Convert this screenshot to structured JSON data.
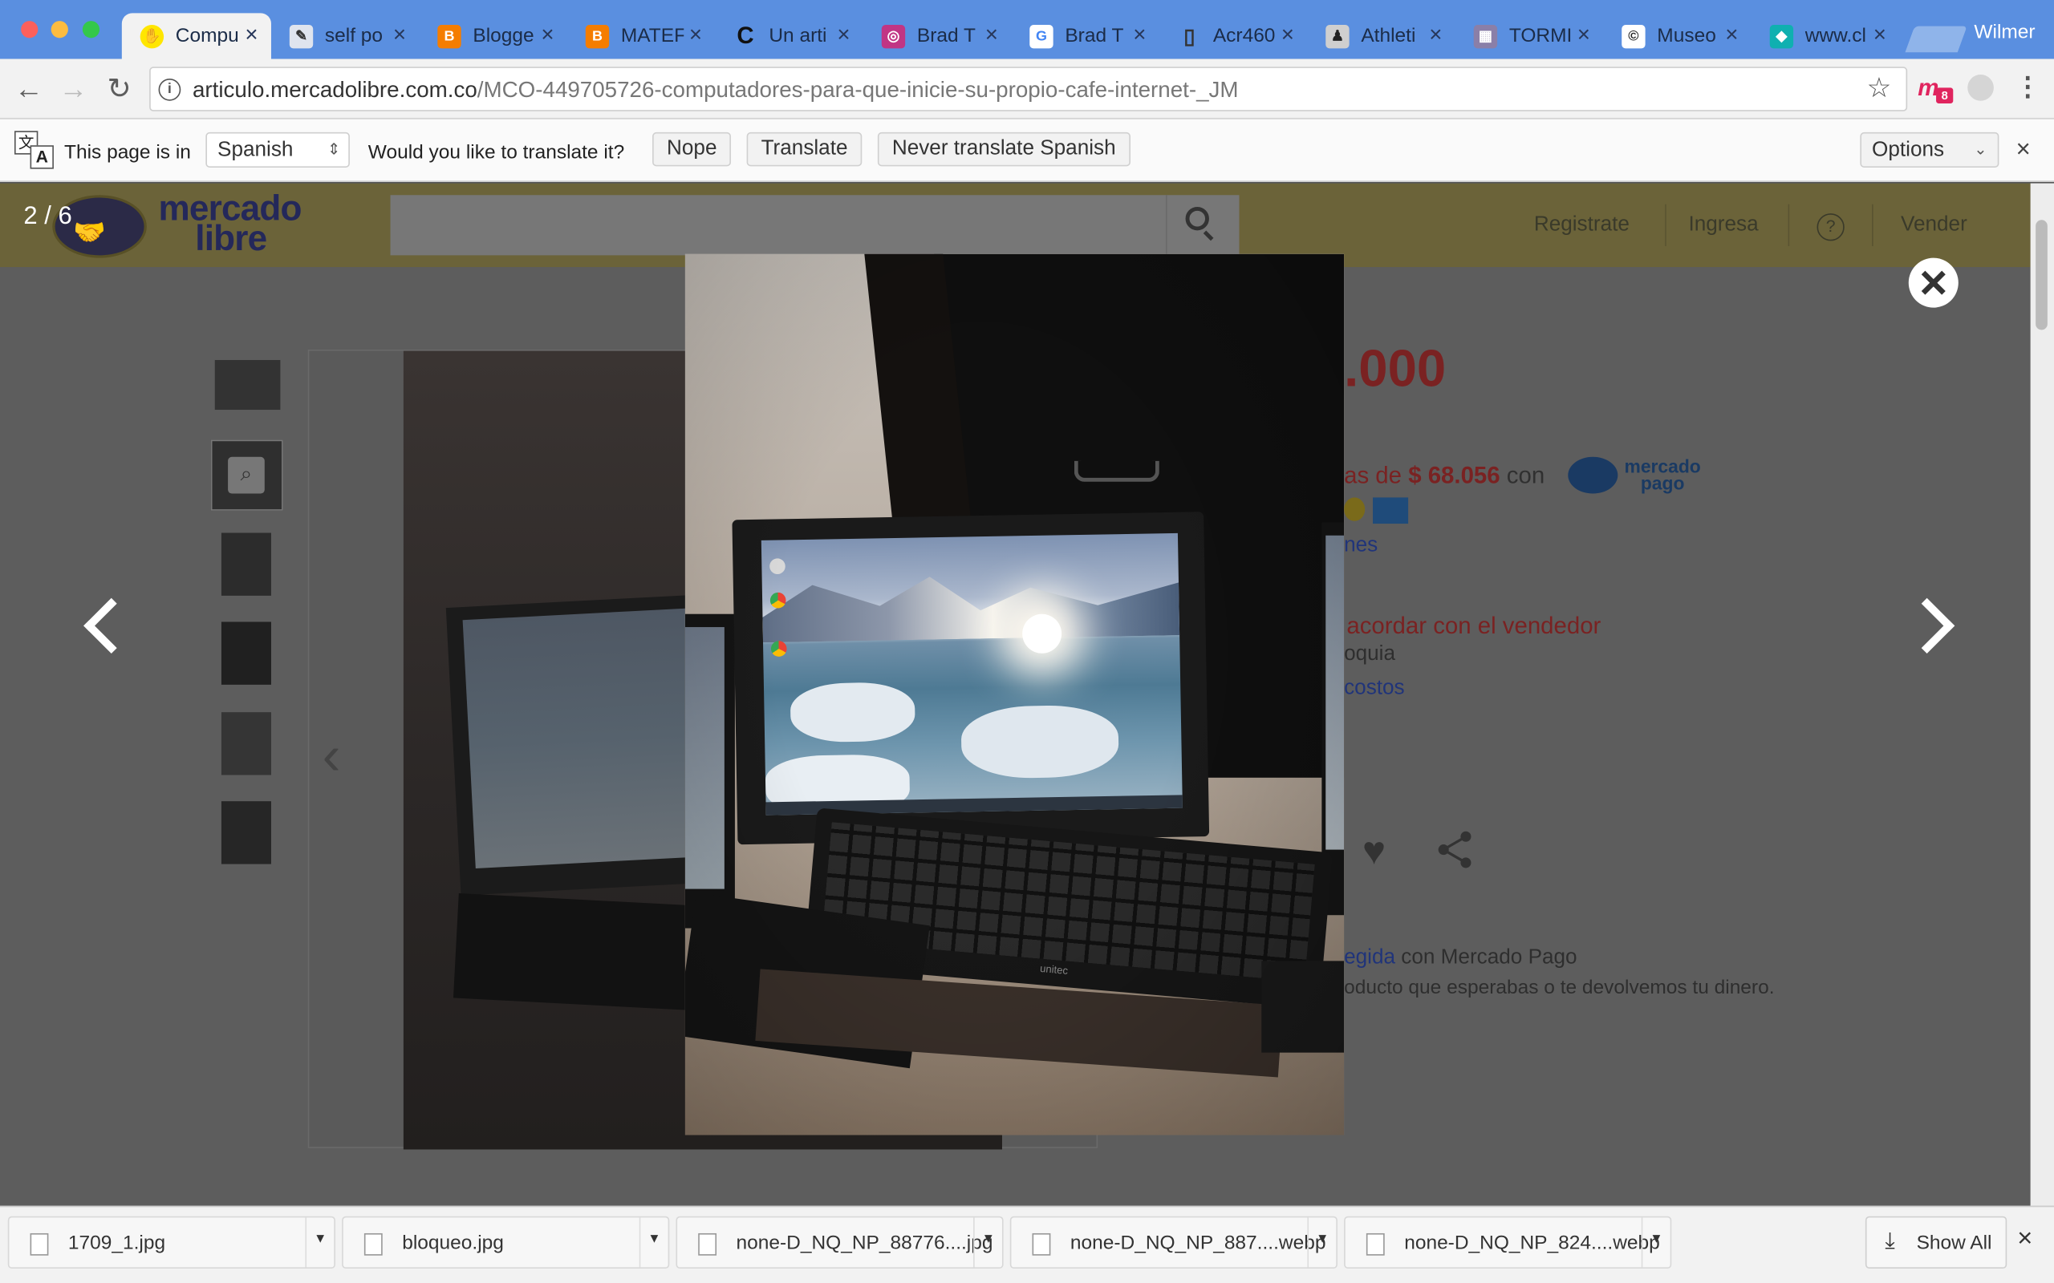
{
  "browser": {
    "user_name": "Wilmer",
    "tabs": [
      {
        "title": "Compu",
        "icon": "mercadolibre-favicon"
      },
      {
        "title": "self po",
        "icon": "image-favicon"
      },
      {
        "title": "Blogge",
        "icon": "blogger-favicon"
      },
      {
        "title": "MATEF",
        "icon": "blogger-favicon"
      },
      {
        "title": "Un arti",
        "icon": "c-favicon"
      },
      {
        "title": "Brad T",
        "icon": "instagram-favicon"
      },
      {
        "title": "Brad T",
        "icon": "google-favicon"
      },
      {
        "title": "Acr460",
        "icon": "document-favicon"
      },
      {
        "title": "Athleti",
        "icon": "image-favicon"
      },
      {
        "title": "TORMI",
        "icon": "image-favicon"
      },
      {
        "title": "Museo",
        "icon": "copyright-favicon"
      },
      {
        "title": "www.cl",
        "icon": "web-favicon"
      }
    ],
    "url_domain": "articulo.mercadolibre.com.co",
    "url_path": "/MCO-449705726-computadores-para-que-inicie-su-propio-cafe-internet-_JM",
    "extension_badge": "8"
  },
  "translate_bar": {
    "page_is_in": "This page is in",
    "language": "Spanish",
    "question": "Would you like to translate it?",
    "nope": "Nope",
    "translate": "Translate",
    "never": "Never translate Spanish",
    "options": "Options"
  },
  "site": {
    "logo_line1": "mercado",
    "logo_line2": "libre",
    "nav": [
      "Registrate",
      "Ingresa",
      "?",
      "Vender"
    ],
    "price": ".000",
    "installments_prefix": "as de",
    "installments_amount": "$ 68.056",
    "installments_con": "con",
    "mp_logo_1": "mercado",
    "mp_logo_2": "pago",
    "more_options": "nes",
    "shipping": "a acordar con el vendedor",
    "location": "oquia",
    "costs": "costos",
    "protected_link": "egida",
    "protected_rest": "con Mercado Pago",
    "protected_desc": "oducto que esperabas o te devolvemos tu dinero."
  },
  "lightbox": {
    "counter": "2 / 6",
    "keyboard_brand": "unitec"
  },
  "downloads": {
    "items": [
      "1709_1.jpg",
      "bloqueo.jpg",
      "none-D_NQ_NP_88776....jpg",
      "none-D_NQ_NP_887....webp",
      "none-D_NQ_NP_824....webp"
    ],
    "show_all": "Show All"
  },
  "colors": {
    "tabstrip": "#5a8fe0",
    "ml_yellow_dimmed": "#6b6339",
    "price_red_dimmed": "#7a2222",
    "link_blue_dimmed": "#20347a"
  }
}
